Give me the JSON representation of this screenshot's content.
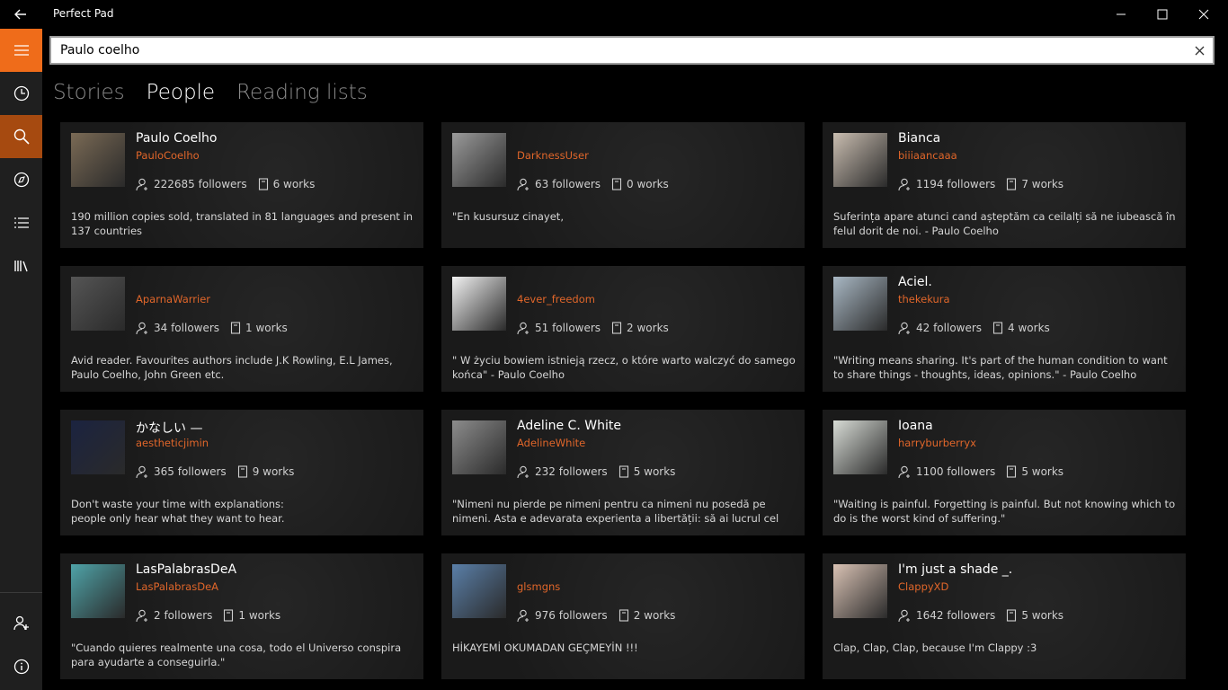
{
  "app": {
    "title": "Perfect Pad"
  },
  "search": {
    "value": "Paulo coelho"
  },
  "tabs": [
    {
      "label": "Stories"
    },
    {
      "label": "People"
    },
    {
      "label": "Reading lists"
    }
  ],
  "colors": {
    "accent": "#ef6c1a",
    "accent_active": "#a64a10",
    "username": "#e0662a"
  },
  "people": [
    {
      "name": "Paulo Coelho",
      "username": "PauloCoelho",
      "followers": "222685 followers",
      "works": "6 works",
      "bio": "190 million copies sold, translated in 81 languages and present in 137 countries",
      "avatar_color": "#7a6a55"
    },
    {
      "name": "",
      "username": "DarknessUser",
      "followers": "63 followers",
      "works": "0 works",
      "bio": "\"En kusursuz cinayet,",
      "avatar_color": "#9a9a9a"
    },
    {
      "name": "Bianca",
      "username": "biiiaancaaa",
      "followers": "1194 followers",
      "works": "7 works",
      "bio": "Suferința apare atunci cand așteptăm ca ceilalți să ne iubească în felul dorit de noi. - Paulo Coelho",
      "avatar_color": "#c9bdb0"
    },
    {
      "name": "",
      "username": "AparnaWarrier",
      "followers": "34 followers",
      "works": "1 works",
      "bio": "Avid reader. Favourites authors include J.K Rowling, E.L James, Paulo Coelho, John Green etc.",
      "avatar_color": "#555555"
    },
    {
      "name": "",
      "username": "4ever_freedom",
      "followers": "51 followers",
      "works": "2 works",
      "bio": "\" W życiu bowiem istnieją rzecz,  o które warto walczyć do samego końca\" - Paulo Coelho",
      "avatar_color": "#f2f2f2"
    },
    {
      "name": "Aciel.",
      "username": "thekekura",
      "followers": "42 followers",
      "works": "4 works",
      "bio": "\"Writing means sharing. It's part of the human condition to want to share things - thoughts, ideas, opinions.\" - Paulo Coelho",
      "avatar_color": "#a9b8c4"
    },
    {
      "name": "かなしい —",
      "username": "aestheticjimin",
      "followers": "365 followers",
      "works": "9 works",
      "bio": "Don't waste your time with explanations:\npeople only hear what they want to hear.",
      "avatar_color": "#1b2340"
    },
    {
      "name": "Adeline C. White",
      "username": "AdelineWhite",
      "followers": "232 followers",
      "works": "5 works",
      "bio": "\"Nimeni nu pierde pe nimeni pentru ca nimeni nu posedă pe nimeni. Asta e adevarata experienta a libertății: să ai lucrul cel mai important...",
      "avatar_color": "#8c8c8c"
    },
    {
      "name": "Ioana",
      "username": "harryburberryx",
      "followers": "1100 followers",
      "works": "5 works",
      "bio": "\"Waiting is painful. Forgetting is painful. But not knowing which to do is the worst kind of suffering.\"",
      "avatar_color": "#d8dcd6"
    },
    {
      "name": "LasPalabrasDeA",
      "username": "LasPalabrasDeA",
      "followers": "2 followers",
      "works": "1 works",
      "bio": "\"Cuando quieres realmente una cosa, todo el Universo conspira para ayudarte a conseguirla.\"",
      "avatar_color": "#4fa3a8"
    },
    {
      "name": "",
      "username": "glsmgns",
      "followers": "976 followers",
      "works": "2 works",
      "bio": "HİKAYEMİ OKUMADAN GEÇMEYİN !!!",
      "avatar_color": "#5a7fa8"
    },
    {
      "name": "I'm just a shade _.",
      "username": "ClappyXD",
      "followers": "1642 followers",
      "works": "5 works",
      "bio": "Clap, Clap, Clap, because I'm Clappy :3",
      "avatar_color": "#d9c2b4"
    }
  ],
  "icons": {
    "back": "back-arrow-icon",
    "minimize": "minimize-icon",
    "maximize": "maximize-icon",
    "close": "close-icon",
    "hamburger": "hamburger-icon",
    "recent": "clock-icon",
    "search": "search-icon",
    "discover": "compass-icon",
    "lists": "list-icon",
    "library": "library-icon",
    "account": "add-person-icon",
    "about": "info-icon",
    "followers": "person-icon",
    "works": "document-icon"
  }
}
